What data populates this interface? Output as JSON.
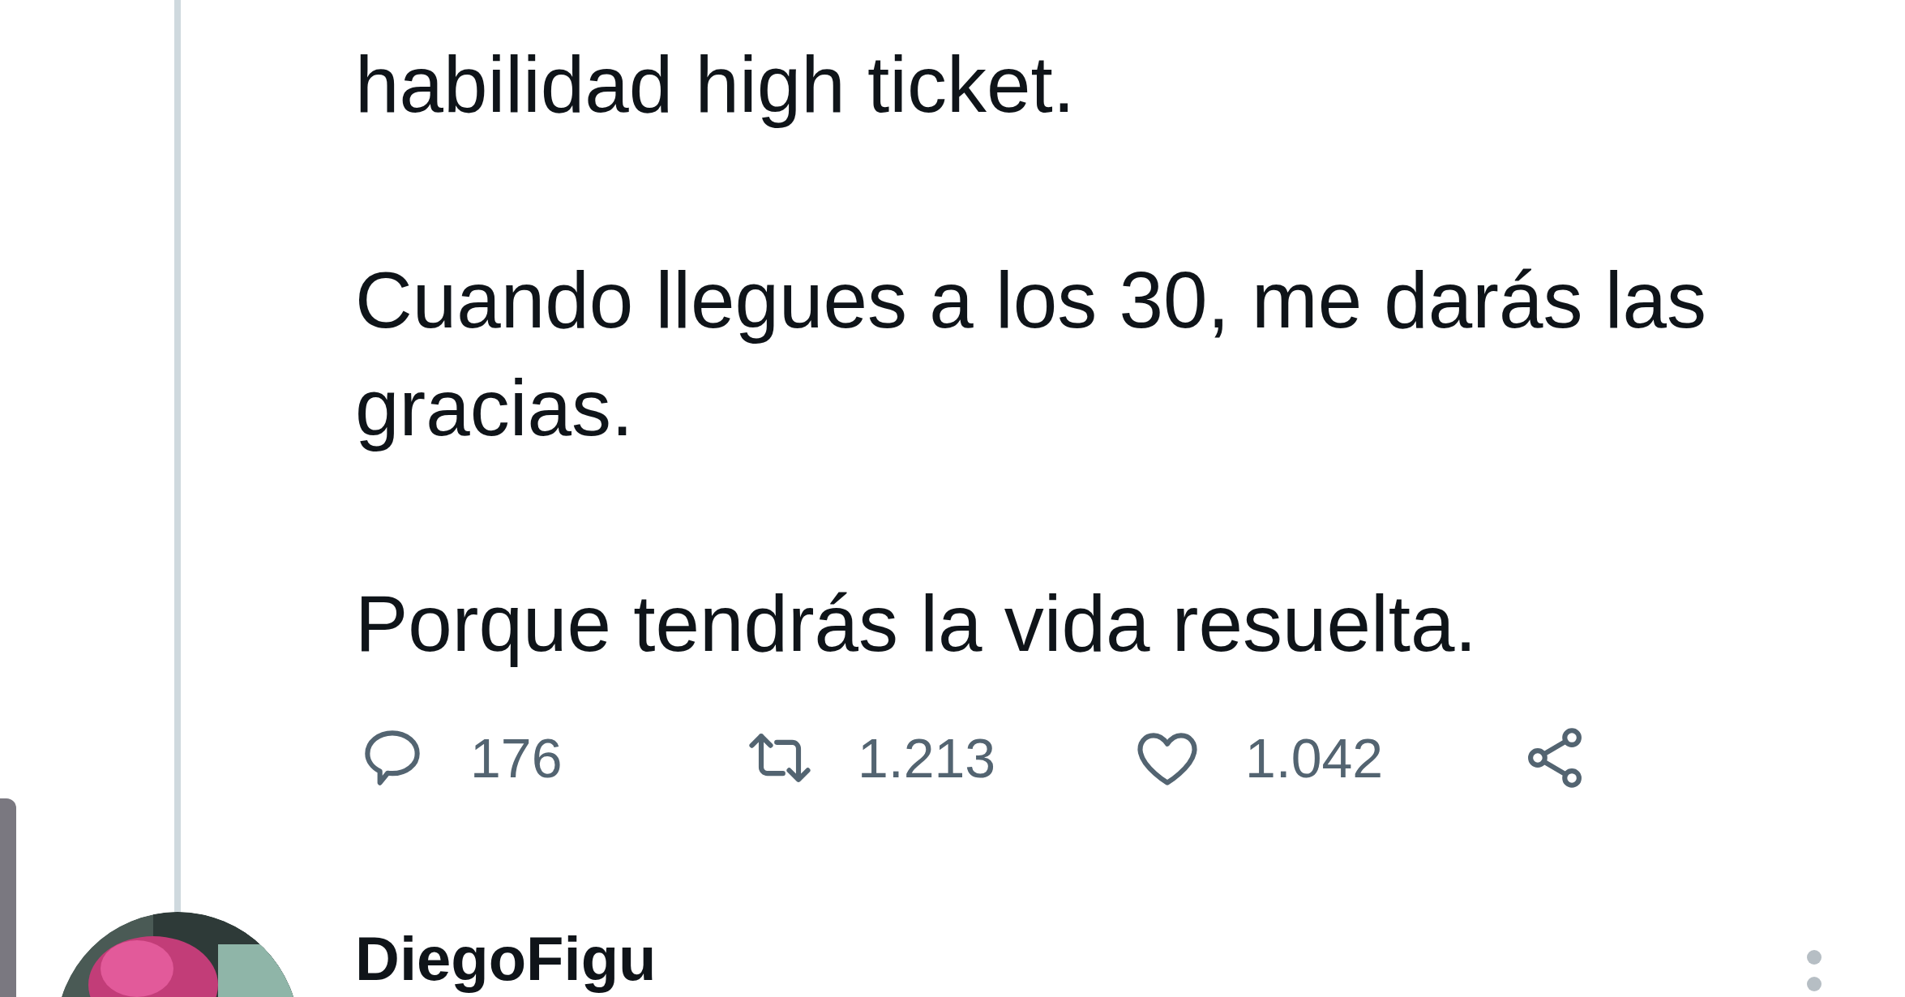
{
  "tweet": {
    "paragraphs": [
      "habilidad high ticket.",
      "Cuando llegues a los 30, me darás las gracias.",
      "Porque tendrás la vida resuelta."
    ],
    "actions": [
      {
        "kind": "reply",
        "count": "176"
      },
      {
        "kind": "retweet",
        "count": "1.213"
      },
      {
        "kind": "like",
        "count": "1.042"
      },
      {
        "kind": "share"
      }
    ]
  },
  "next_tweet": {
    "author": "DiegoFigu"
  }
}
